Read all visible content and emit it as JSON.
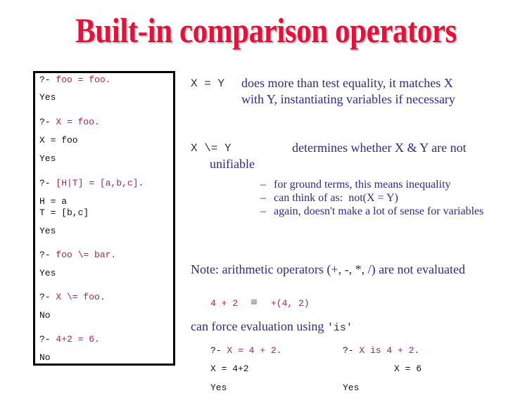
{
  "title": "Built-in comparison operators",
  "colors": {
    "title": "#e8103a",
    "body_text": "#2b2b8a",
    "query": "#a4245a",
    "output": "#111111",
    "box_border": "#000000"
  },
  "query_box": {
    "lines": [
      {
        "prompt": "?- ",
        "query": "foo = foo."
      },
      {
        "output": "Yes"
      },
      {
        "prompt": "?- ",
        "query": "X = foo."
      },
      {
        "output": "X = foo"
      },
      {
        "output": "Yes"
      },
      {
        "prompt": "?- ",
        "query": "[H|T] = [a,b,c]."
      },
      {
        "output": "H = a"
      },
      {
        "output": "T = [b,c]"
      },
      {
        "output": "Yes"
      },
      {
        "prompt": "?- ",
        "query": "foo \\= bar."
      },
      {
        "output": "Yes"
      },
      {
        "prompt": "?- ",
        "query": "X \\= foo."
      },
      {
        "output": "No"
      },
      {
        "prompt": "?- ",
        "query": "4+2 = 6."
      },
      {
        "output": "No"
      }
    ]
  },
  "unify": {
    "code": "X = Y",
    "line1": "does more than test equality, it matches X",
    "line2": "with Y, instantiating variables if necessary"
  },
  "not_unify": {
    "code": "X \\= Y",
    "line1": "determines whether X & Y are not",
    "line2": "unifiable",
    "bullets": [
      "for ground terms, this means inequality",
      "can think of as:  not(X = Y)",
      "again, doesn't make a lot of sense for variables"
    ],
    "bullet_marker": "–"
  },
  "note": {
    "text": "Note: arithmetic operators (+, -, *, /) are not evaluated",
    "expr_left": "4 + 2",
    "equiv_symbol": "≡",
    "expr_right": "+(4, 2)",
    "force_text": "can force evaluation using ",
    "force_code": "'is'"
  },
  "examples": {
    "left": {
      "prompt": "?- ",
      "query": "X = 4 + 2.",
      "result": "X = 4+2",
      "answer": "Yes"
    },
    "right": {
      "prompt": "?- ",
      "query": "X is 4 + 2.",
      "result": "X = 6",
      "answer": "Yes"
    }
  }
}
